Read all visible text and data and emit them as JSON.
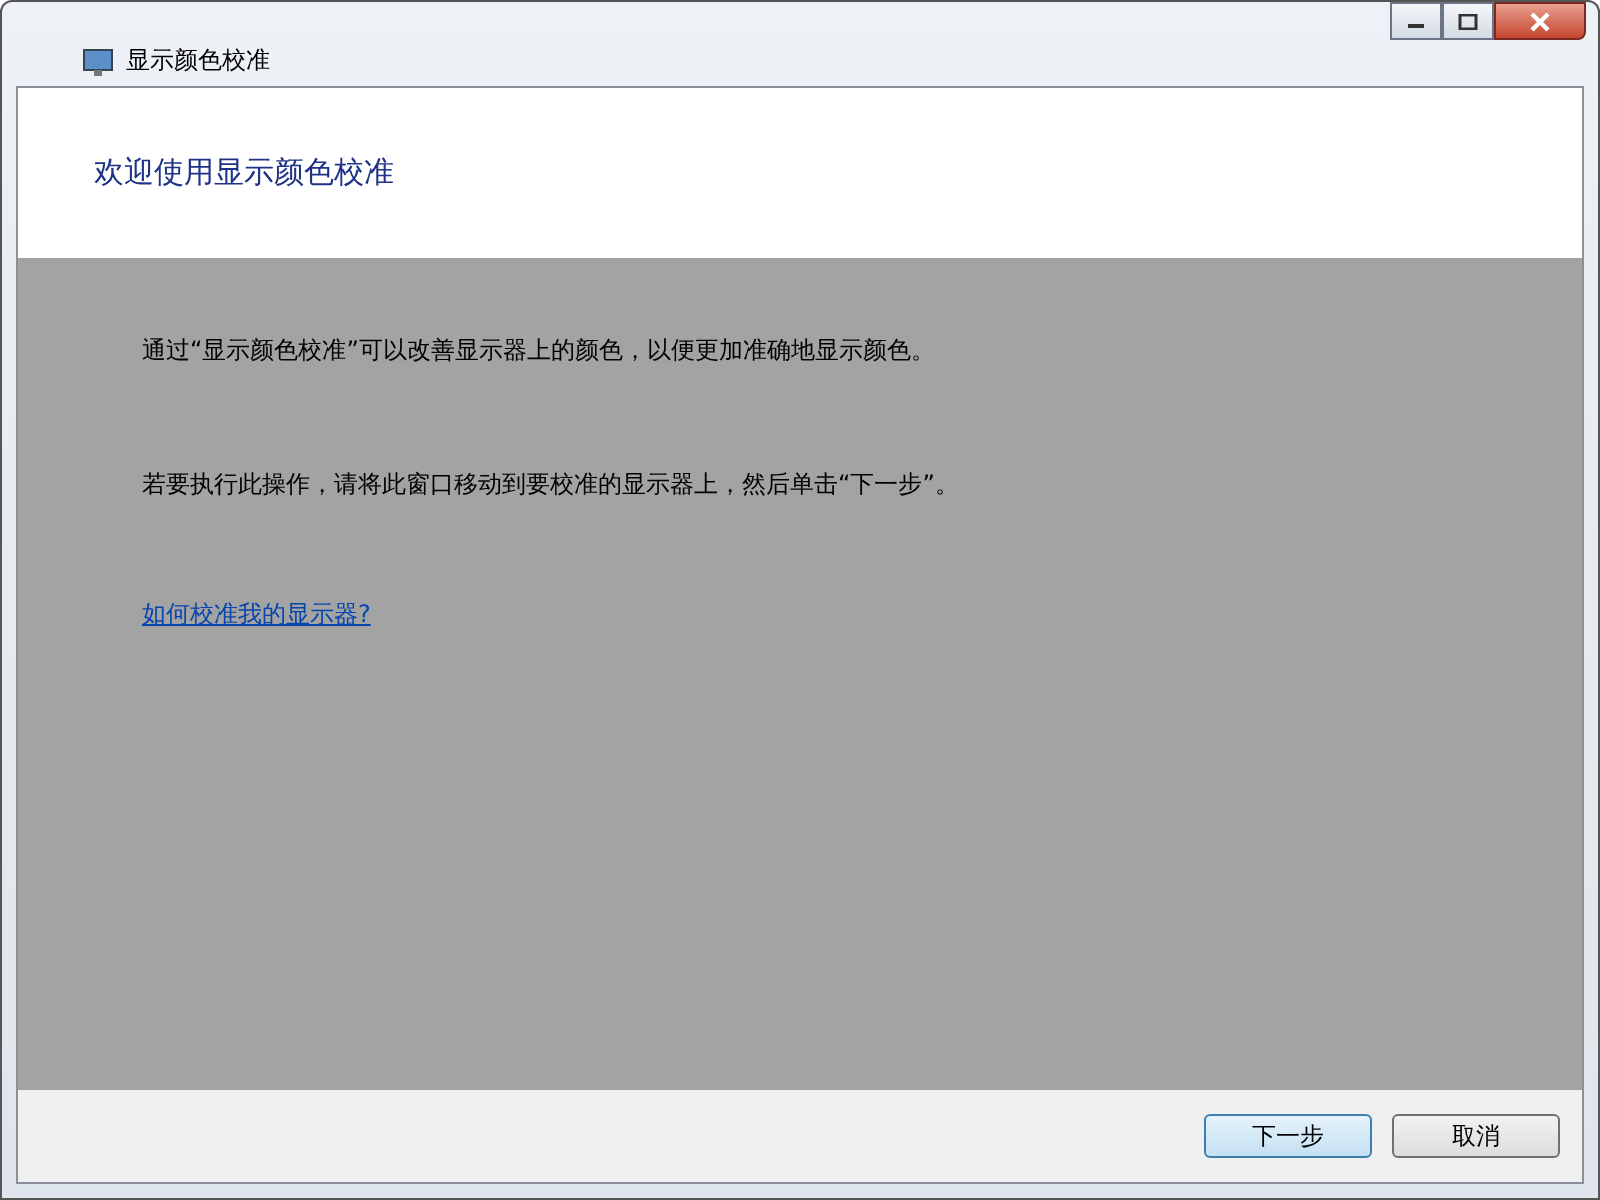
{
  "window": {
    "title": "显示颜色校准"
  },
  "header": {
    "title": "欢迎使用显示颜色校准"
  },
  "paragraphs": [
    "通过“显示颜色校准”可以改善显示器上的颜色，以便更加准确地显示颜色。",
    "若要执行此操作，请将此窗口移动到要校准的显示器上，然后单击“下一步”。"
  ],
  "link": "如何校准我的显示器?",
  "buttons": [
    {
      "label": "下一步",
      "selected": true
    },
    {
      "label": "取消",
      "selected": false
    }
  ]
}
